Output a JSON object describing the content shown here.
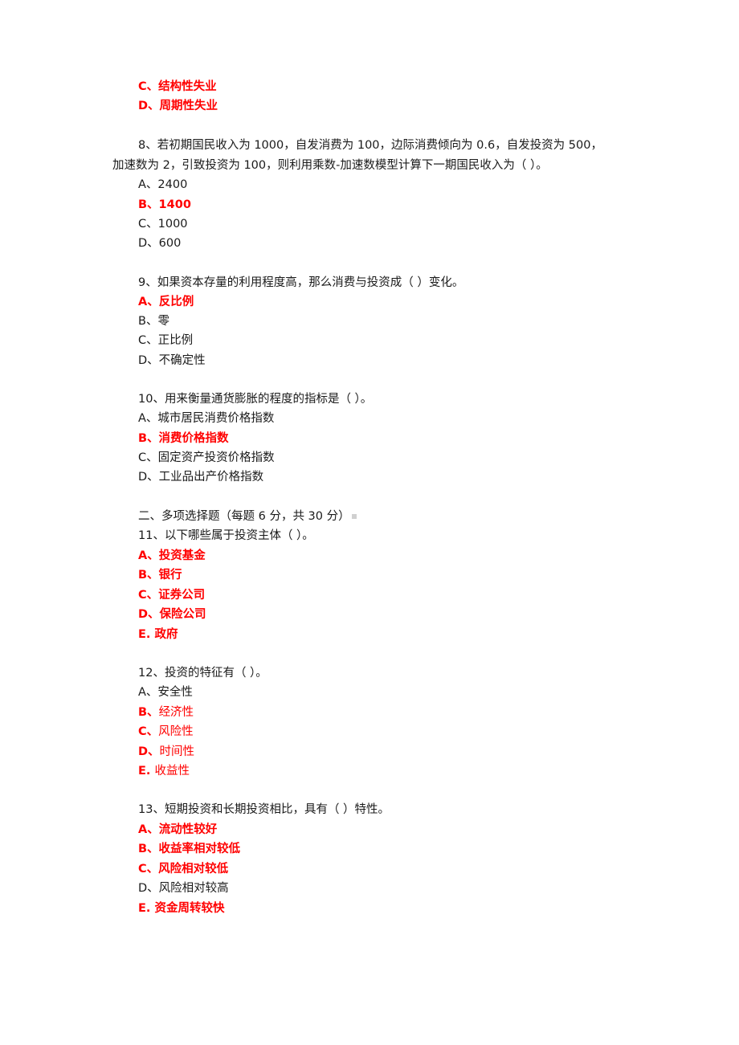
{
  "carryover": {
    "options": [
      {
        "text": "C、结构性失业",
        "correct": true
      },
      {
        "text": "D、周期性失业",
        "correct": true
      }
    ]
  },
  "q8": {
    "line1": "8、若初期国民收入为 1000，自发消费为 100，边际消费倾向为 0.6，自发投资为 500，",
    "line2": "加速数为 2，引致投资为 100，则利用乘数-加速数模型计算下一期国民收入为（ ）。",
    "options": [
      {
        "text": "A、2400",
        "correct": false
      },
      {
        "text": "B、1400",
        "correct": true
      },
      {
        "text": "C、1000",
        "correct": false
      },
      {
        "text": "D、600",
        "correct": false
      }
    ]
  },
  "q9": {
    "question": "9、如果资本存量的利用程度高，那么消费与投资成（ ）变化。",
    "options": [
      {
        "text": "A、反比例",
        "correct": true
      },
      {
        "text": "B、零",
        "correct": false
      },
      {
        "text": "C、正比例",
        "correct": false
      },
      {
        "text": "D、不确定性",
        "correct": false
      }
    ]
  },
  "q10": {
    "question": "10、用来衡量通货膨胀的程度的指标是（ ）。",
    "options": [
      {
        "text": "A、城市居民消费价格指数",
        "correct": false
      },
      {
        "text": "B、消费价格指数",
        "correct": true
      },
      {
        "text": "C、固定资产投资价格指数",
        "correct": false
      },
      {
        "text": "D、工业品出产价格指数",
        "correct": false
      }
    ]
  },
  "section2": {
    "heading": "二、多项选择题（每题 6 分，共 30 分）"
  },
  "q11": {
    "question": "11、以下哪些属于投资主体（ ）。",
    "options": [
      {
        "text": "A、投资基金",
        "correct": true
      },
      {
        "text": "B、银行",
        "correct": true
      },
      {
        "text": "C、证券公司",
        "correct": true
      },
      {
        "text": "D、保险公司",
        "correct": true
      },
      {
        "text": "E. 政府",
        "correct": true
      }
    ]
  },
  "q12": {
    "question": "12、投资的特征有（ ）。",
    "options": [
      {
        "letter": "A、",
        "body": "安全性",
        "correct": false
      },
      {
        "letter": "B、",
        "body": "经济性",
        "correct": true
      },
      {
        "letter": "C、",
        "body": "风险性",
        "correct": true
      },
      {
        "letter": "D、",
        "body": "时间性",
        "correct": true
      },
      {
        "letter": "E. ",
        "body": "收益性",
        "correct": true
      }
    ]
  },
  "q13": {
    "question": "13、短期投资和长期投资相比，具有（ ）特性。",
    "options": [
      {
        "text": "A、流动性较好",
        "correct": true
      },
      {
        "text": "B、收益率相对较低",
        "correct": true
      },
      {
        "text": "C、风险相对较低",
        "correct": true
      },
      {
        "text": "D、风险相对较高",
        "correct": false
      },
      {
        "text": "E. 资金周转较快",
        "correct": true
      }
    ]
  },
  "colors": {
    "correct": "#ff0000",
    "text": "#1a1a1a"
  }
}
